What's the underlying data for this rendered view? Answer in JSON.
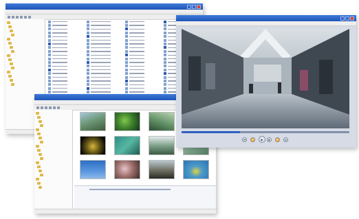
{
  "colors": {
    "title_bar": "#2a62c8",
    "selection": "#2e5bb0",
    "folder": "#e0b84a",
    "media_bar": "#d6dbe5"
  },
  "explorer": {
    "title": "",
    "tree_nodes": [
      "",
      "",
      "",
      "",
      "",
      "",
      "",
      "",
      "",
      "",
      "",
      "",
      "",
      "",
      "",
      ""
    ]
  },
  "thumbs": {
    "title": "",
    "tree_nodes": [
      "",
      "",
      "",
      "",
      "",
      "",
      "",
      "",
      "",
      "",
      "",
      "",
      "",
      "",
      "",
      "",
      "",
      "",
      ""
    ],
    "captions": [
      "",
      "",
      "",
      "",
      "",
      "",
      "",
      "",
      "",
      "",
      "",
      ""
    ],
    "properties": {
      "left": [
        "",
        "",
        "",
        ""
      ],
      "mid": [
        "",
        "",
        "",
        ""
      ],
      "right": [
        "",
        "",
        ""
      ]
    }
  },
  "player": {
    "title": "",
    "progress": 0.35,
    "controls": [
      "prev-icon",
      "rewind-icon",
      "play-icon",
      "stop-icon",
      "forward-icon",
      "next-icon"
    ]
  }
}
